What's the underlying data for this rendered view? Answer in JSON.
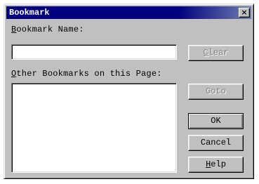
{
  "window": {
    "title": "Bookmark",
    "close_glyph": "×"
  },
  "name_field": {
    "label_acc": "B",
    "label_rest": "ookmark Name:",
    "value": ""
  },
  "other_list": {
    "label_acc": "O",
    "label_rest": "ther Bookmarks on this Page:",
    "items": []
  },
  "buttons": {
    "clear": {
      "acc": "C",
      "rest": "lear",
      "enabled": false
    },
    "goto": {
      "label": "Goto",
      "enabled": false
    },
    "ok": {
      "label": "OK",
      "default": true
    },
    "cancel": {
      "label": "Cancel"
    },
    "help": {
      "acc": "H",
      "rest": "elp"
    }
  },
  "icons": {
    "close": "close-icon"
  }
}
